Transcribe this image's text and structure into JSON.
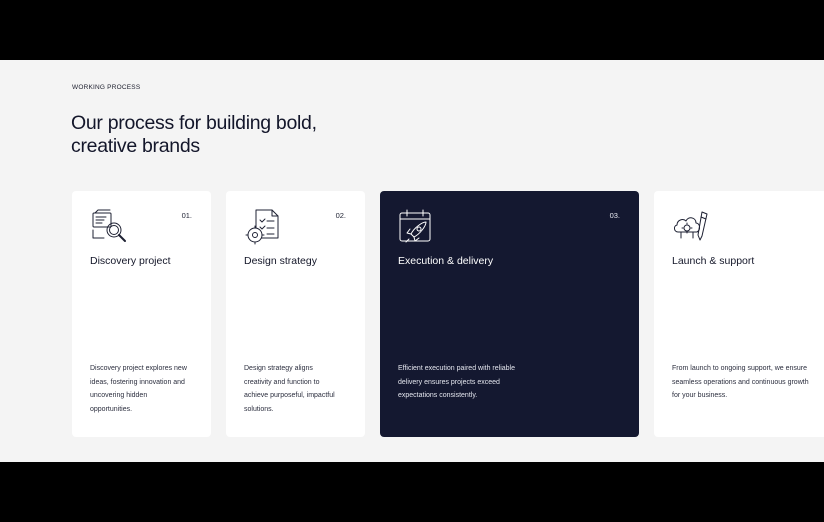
{
  "section": {
    "eyebrow": "WORKING PROCESS",
    "heading_line1": "Our process for building bold,",
    "heading_line2": "creative brands"
  },
  "cards": [
    {
      "number": "01.",
      "title": "Discovery project",
      "desc_lines": [
        "Discovery project explores new",
        "ideas, fostering innovation and",
        "uncovering hidden",
        "opportunities."
      ],
      "icon": "research-magnifier-icon"
    },
    {
      "number": "02.",
      "title": "Design strategy",
      "desc_lines": [
        "Design strategy aligns",
        "creativity and function to",
        "achieve purposeful, impactful",
        "solutions."
      ],
      "icon": "strategy-checklist-gear-icon"
    },
    {
      "number": "03.",
      "title": "Execution & delivery",
      "desc_lines": [
        "Efficient execution paired with reliable",
        "delivery ensures projects exceed",
        "expectations consistently."
      ],
      "icon": "calendar-rocket-icon"
    },
    {
      "number": "",
      "title": "Launch & support",
      "desc_lines": [
        "From launch to ongoing support, we ensure",
        "seamless operations and continuous growth",
        "for your business."
      ],
      "icon": "cloud-gear-pencil-icon"
    }
  ],
  "colors": {
    "page_band": "#000000",
    "section_bg": "#f4f4f4",
    "card_bg": "#ffffff",
    "card_active_bg": "#141830",
    "text_dark": "#13162a"
  }
}
